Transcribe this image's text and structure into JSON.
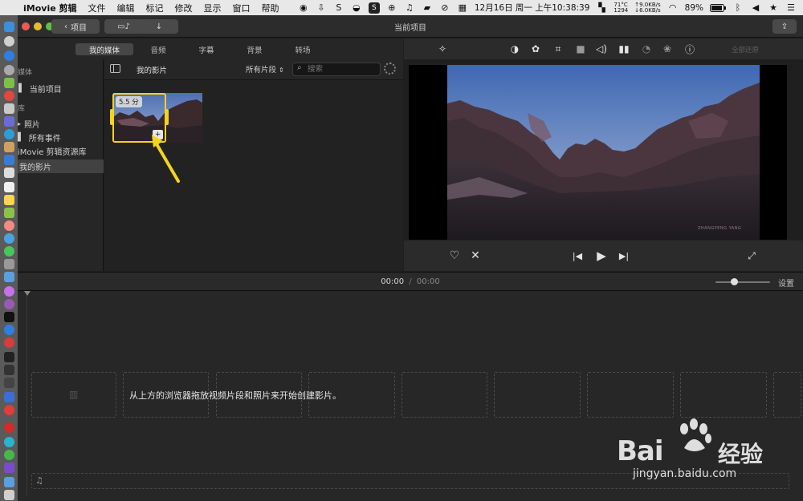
{
  "menubar": {
    "apple": "",
    "app_name": "iMovie 剪辑",
    "items": [
      "文件",
      "编辑",
      "标记",
      "修改",
      "显示",
      "窗口",
      "帮助"
    ],
    "s_icon": "S",
    "temp": "71°C",
    "fan": "1294",
    "net_up": "↑9.0KB/s",
    "net_down": "↓6.0KB/s",
    "datetime": "12月16日 周一 上午10:38:39",
    "battery": "89%"
  },
  "window": {
    "title": "当前项目",
    "back_button": "项目"
  },
  "tabs": [
    "我的媒体",
    "音频",
    "字幕",
    "背景",
    "转场"
  ],
  "sidebar": {
    "section_media": "媒体",
    "current_project": "当前项目",
    "section_library": "库",
    "photos": "照片",
    "all_events": "所有事件",
    "library_name": "iMovie 剪辑资源库",
    "my_movie": "我的影片"
  },
  "browser": {
    "title": "我的影片",
    "filter": "所有片段",
    "search_placeholder": "搜索",
    "clip_duration": "5.5 分"
  },
  "viewer": {
    "auto_enhance": "全部还原",
    "watermark": "ZHANGPENG YANG"
  },
  "timeline": {
    "current_time": "00:00",
    "separator": "/",
    "total_time": "00:00",
    "settings": "设置",
    "hint": "从上方的浏览器拖放视频片段和照片来开始创建影片。"
  },
  "baidu": {
    "logo_left": "Bai",
    "logo_right": "经验",
    "url": "jingyan.baidu.com"
  },
  "colors": {
    "accent_yellow": "#f5d31c",
    "dark_bg": "#1f1f1f"
  }
}
